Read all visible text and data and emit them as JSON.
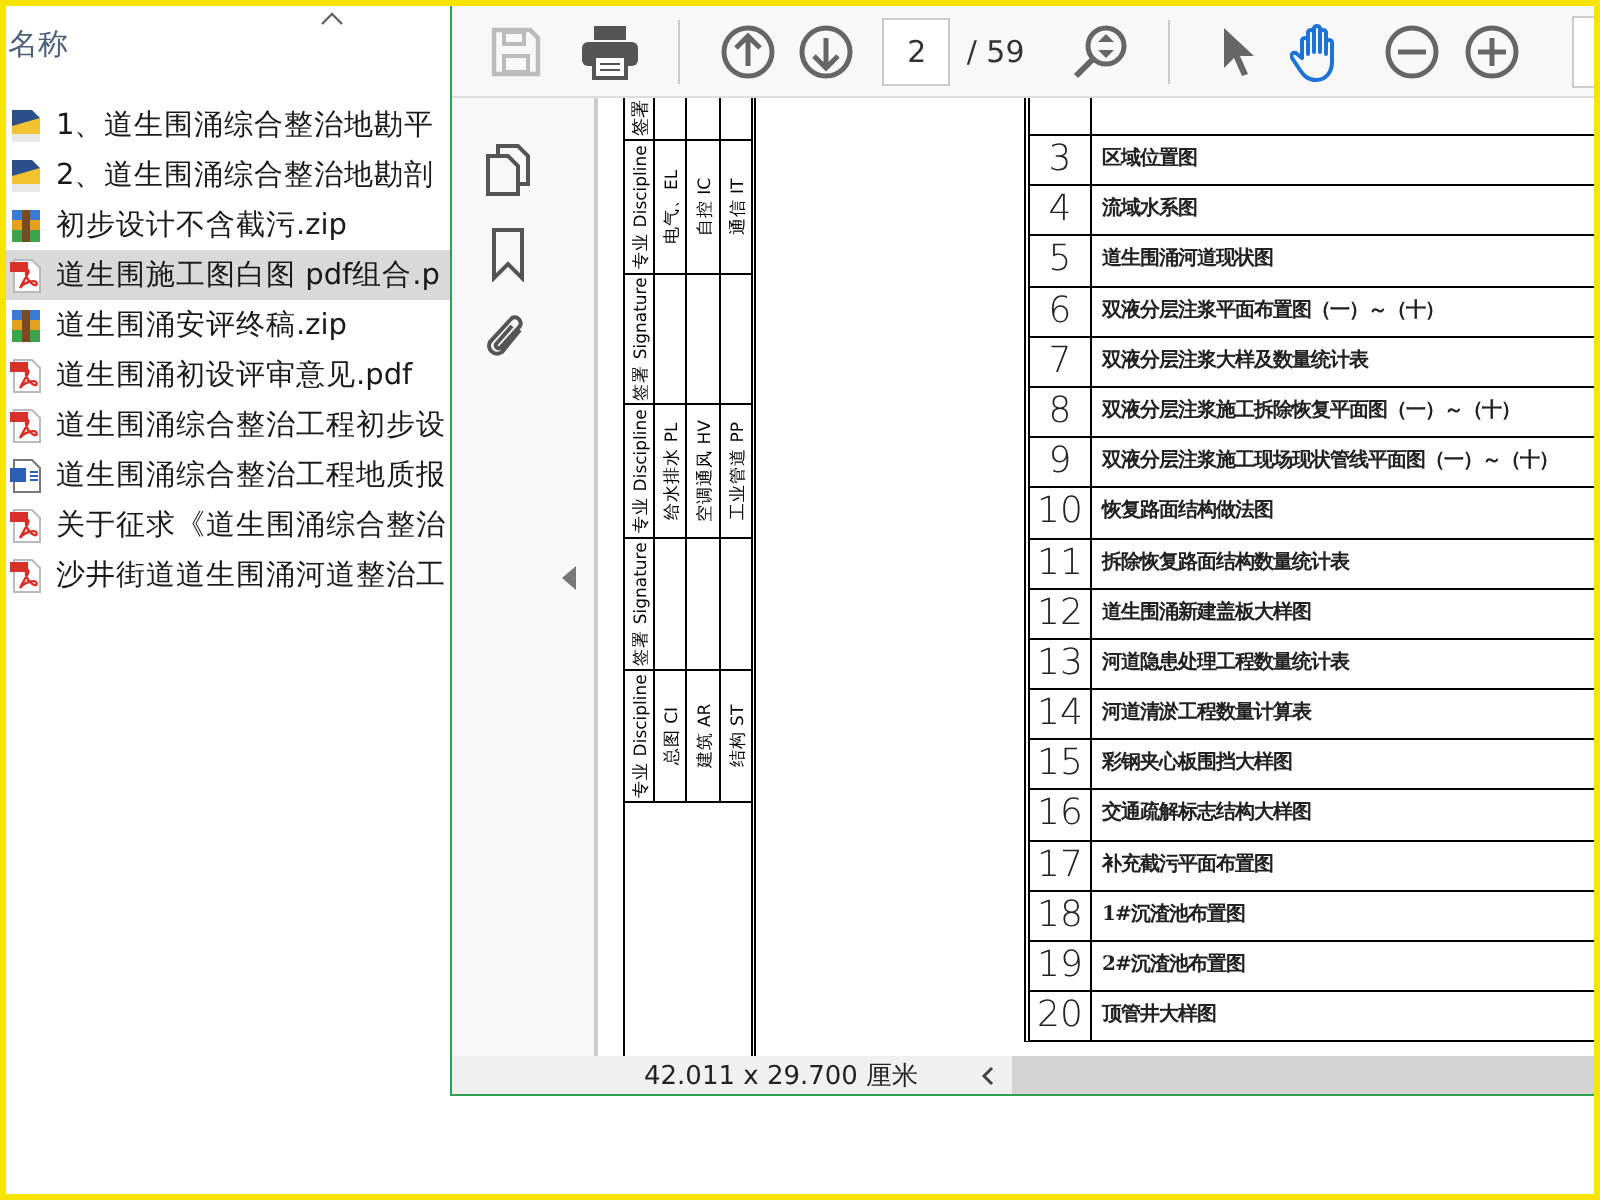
{
  "explorer": {
    "column_header": "名称",
    "items": [
      {
        "name": "1、道生围涌综合整治地勘平",
        "kind": "dwg",
        "selected": false
      },
      {
        "name": "2、道生围涌综合整治地勘剖",
        "kind": "dwg",
        "selected": false
      },
      {
        "name": "初步设计不含截污.zip",
        "kind": "zip",
        "selected": false
      },
      {
        "name": "道生围施工图白图 pdf组合.p",
        "kind": "pdf",
        "selected": true
      },
      {
        "name": "道生围涌安评终稿.zip",
        "kind": "zip",
        "selected": false
      },
      {
        "name": "道生围涌初设评审意见.pdf",
        "kind": "pdf",
        "selected": false
      },
      {
        "name": "道生围涌综合整治工程初步设",
        "kind": "pdf",
        "selected": false
      },
      {
        "name": "道生围涌综合整治工程地质报",
        "kind": "doc",
        "selected": false
      },
      {
        "name": "关于征求《道生围涌综合整治",
        "kind": "pdf",
        "selected": false
      },
      {
        "name": "沙井街道道生围涌河道整治工",
        "kind": "pdf",
        "selected": false
      }
    ]
  },
  "viewer": {
    "toolbar": {
      "save_disabled": true,
      "page_number": "2",
      "page_total": "/ 59",
      "tools": [
        {
          "kind": "pointer",
          "selected": false
        },
        {
          "kind": "hand",
          "selected": true
        }
      ]
    },
    "document": {
      "title_block": {
        "top_fragment": "签署",
        "sections": [
          {
            "header": "专业 Discipline",
            "cells": [
              "电气、EL",
              "自控 IC",
              "通信 IT"
            ]
          },
          {
            "header": "签署 Signature"
          },
          {
            "header": "专业 Discipline",
            "cells": [
              "给水排水 PL",
              "空调通风 HV",
              "工业管道 PP"
            ]
          },
          {
            "header": "签署 Signature"
          },
          {
            "header": "专业 Discipline",
            "cells": [
              "总图 CI",
              "建筑 AR",
              "结构 ST"
            ]
          }
        ]
      },
      "drawing_list": [
        {
          "number": "3",
          "title": "区域位置图"
        },
        {
          "number": "4",
          "title": "流域水系图"
        },
        {
          "number": "5",
          "title": "道生围涌河道现状图"
        },
        {
          "number": "6",
          "title": "双液分层注浆平面布置图（一）～（十）"
        },
        {
          "number": "7",
          "title": "双液分层注浆大样及数量统计表"
        },
        {
          "number": "8",
          "title": "双液分层注浆施工拆除恢复平面图（一）～（十）"
        },
        {
          "number": "9",
          "title": "双液分层注浆施工现场现状管线平面图（一）～（十）"
        },
        {
          "number": "10",
          "title": "恢复路面结构做法图"
        },
        {
          "number": "11",
          "title": "拆除恢复路面结构数量统计表"
        },
        {
          "number": "12",
          "title": "道生围涌新建盖板大样图"
        },
        {
          "number": "13",
          "title": "河道隐患处理工程数量统计表"
        },
        {
          "number": "14",
          "title": "河道清淤工程数量计算表"
        },
        {
          "number": "15",
          "title": "彩钢夹心板围挡大样图"
        },
        {
          "number": "16",
          "title": "交通疏解标志结构大样图"
        },
        {
          "number": "17",
          "title": "补充截污平面布置图"
        },
        {
          "number": "18",
          "title": "1#沉渣池布置图"
        },
        {
          "number": "19",
          "title": "2#沉渣池布置图"
        },
        {
          "number": "20",
          "title": "顶管井大样图"
        }
      ]
    },
    "status_bar": {
      "page_size": "42.011 x 29.700 厘米"
    }
  }
}
